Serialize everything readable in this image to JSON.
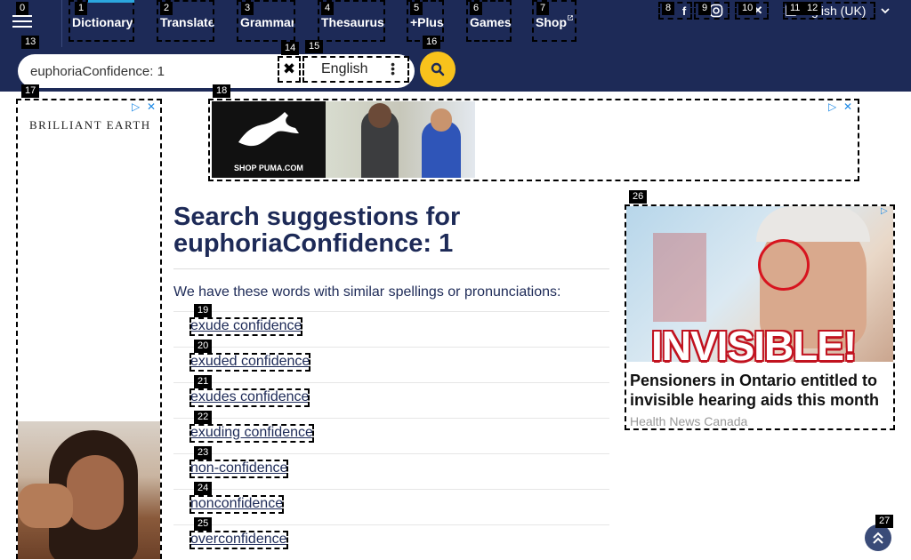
{
  "nav": {
    "items": [
      {
        "label": "Dictionary",
        "active": true
      },
      {
        "label": "Translate"
      },
      {
        "label": "Grammar"
      },
      {
        "label": "Thesaurus"
      },
      {
        "label": "+Plus"
      },
      {
        "label": "Games"
      },
      {
        "label": "Shop"
      }
    ],
    "language": "English (UK)",
    "language_partial": "glish (UK)"
  },
  "search": {
    "value": "euphoriaConfidence: 1",
    "dictionary": "English"
  },
  "ads": {
    "left_brand": "BRILLIANT EARTH",
    "top_brand": "SHOP PUMA.COM",
    "right_overlay": "INVISIBLE!",
    "right_headline": "Pensioners in Ontario entitled to invisible hearing aids this month",
    "right_source": "Health News Canada"
  },
  "main": {
    "heading_prefix": "Search suggestions for",
    "heading_query": "euphoriaConfidence: 1",
    "intro": "We have these words with similar spellings or pronunciations:",
    "suggestions": [
      "exude confidence",
      "exuded confidence",
      "exudes confidence",
      "exuding confidence",
      "non-confidence",
      "nonconfidence",
      "overconfidence"
    ]
  },
  "badges": [
    "0",
    "1",
    "2",
    "3",
    "4",
    "5",
    "6",
    "7",
    "8",
    "9",
    "10",
    "11",
    "12",
    "13",
    "14",
    "15",
    "16",
    "17",
    "18",
    "19",
    "20",
    "21",
    "22",
    "23",
    "24",
    "25",
    "26",
    "27"
  ],
  "colors": {
    "header": "#1d2a57",
    "accent": "#f8c21c",
    "link": "#1d2a57"
  }
}
